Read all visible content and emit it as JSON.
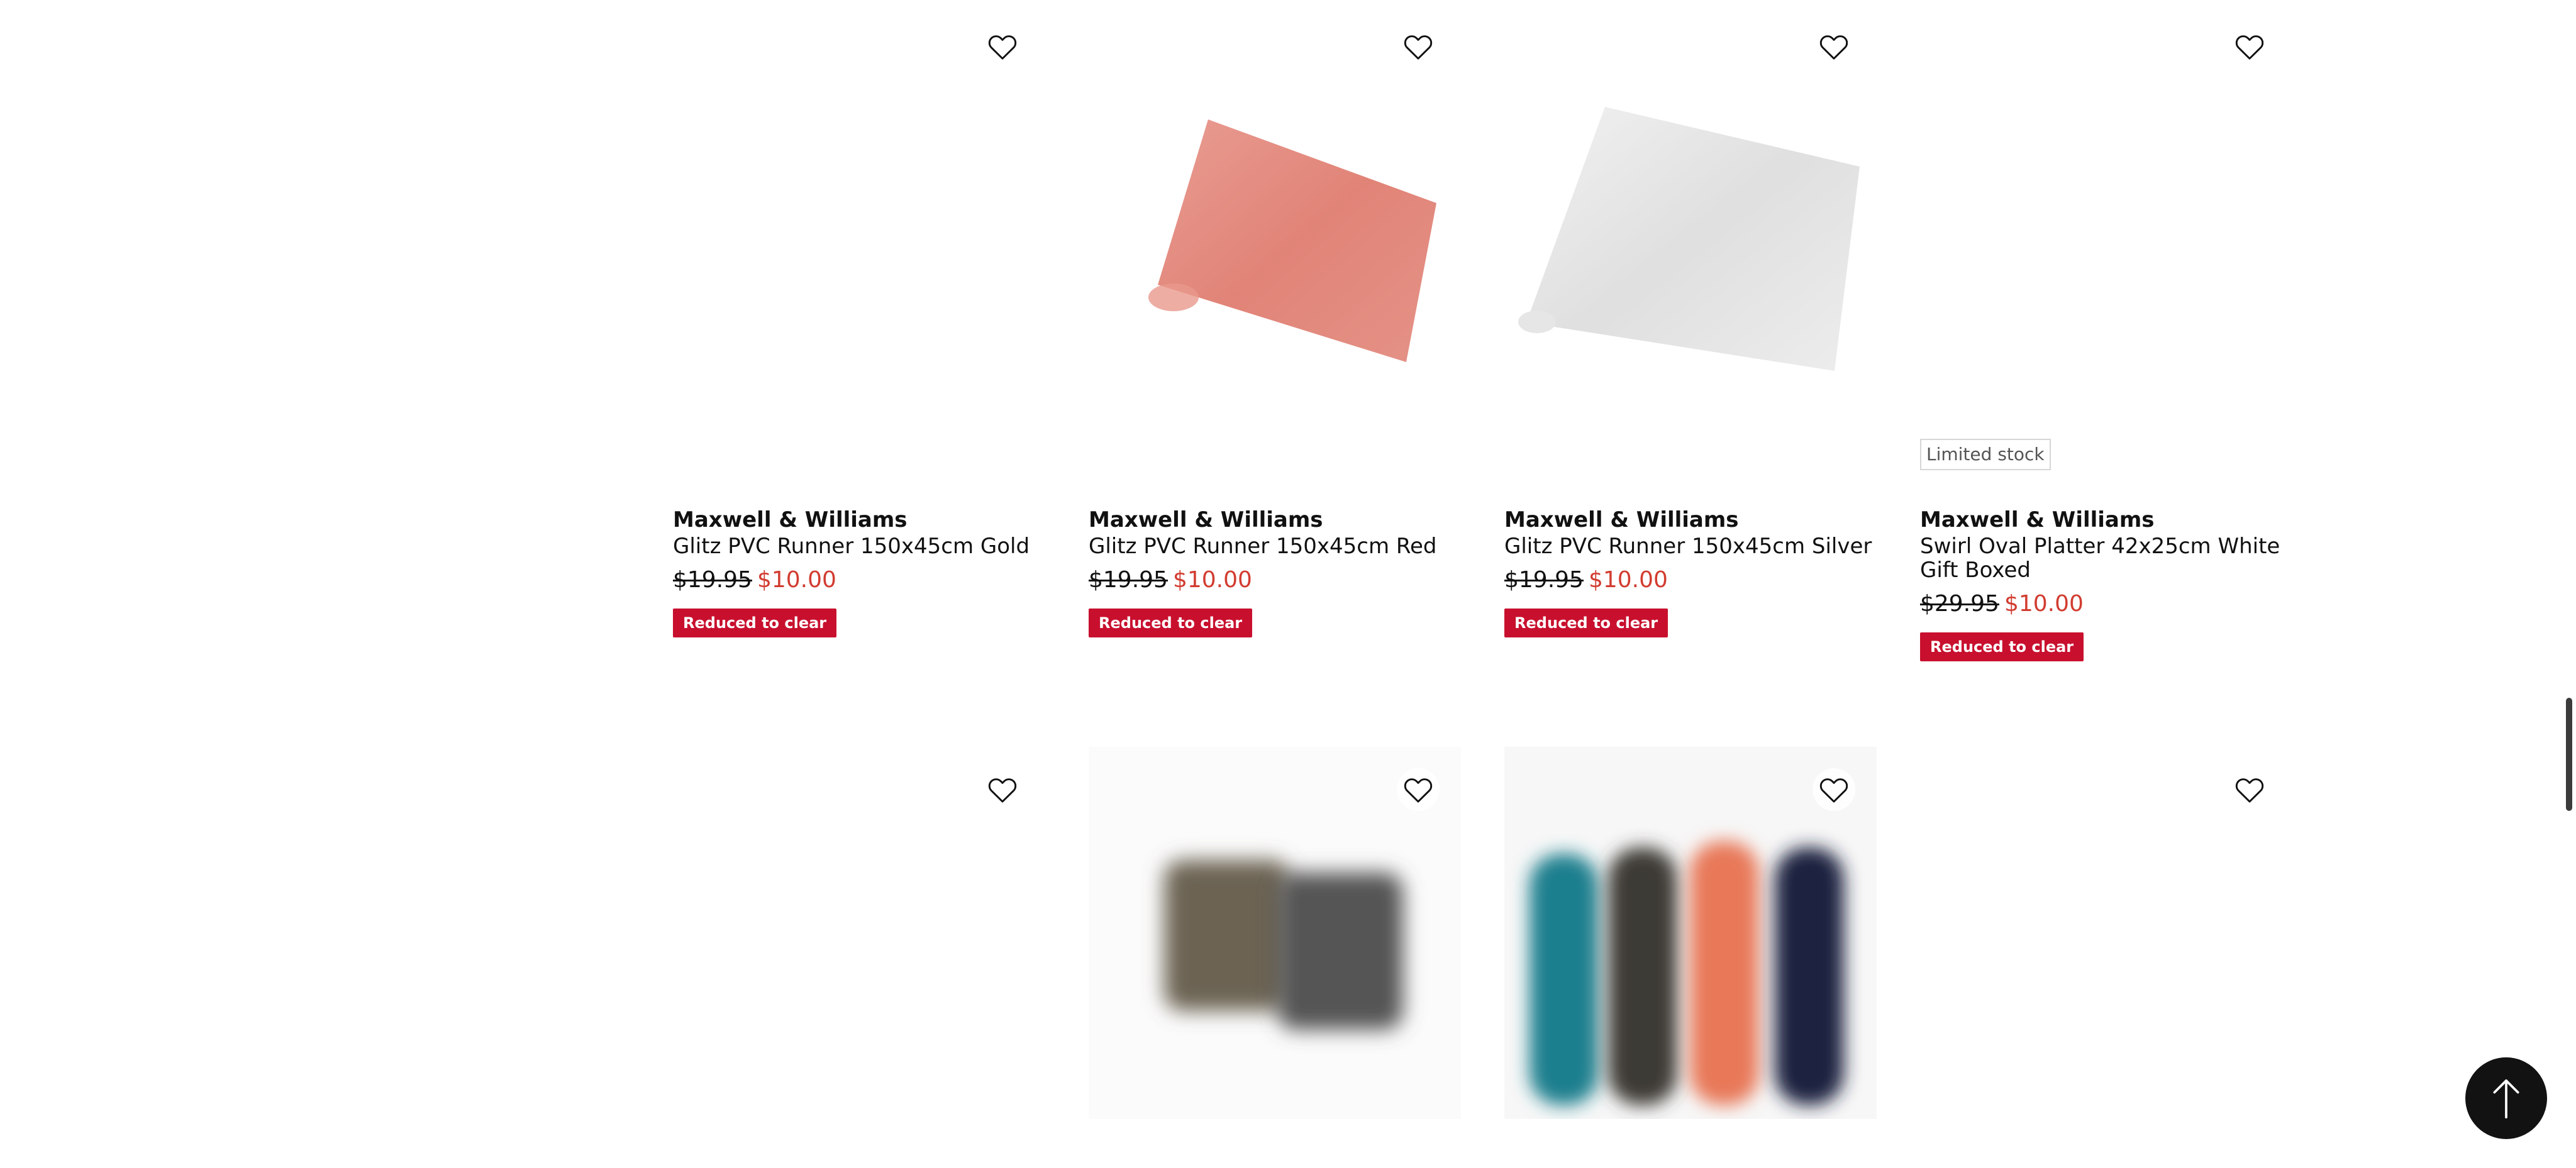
{
  "products_row1": [
    {
      "brand": "Maxwell & Williams",
      "name": "Glitz PVC Runner 150x45cm Gold",
      "was_price": "$19.95",
      "now_price": "$10.00",
      "badge": "Reduced to clear",
      "image_color": "#ffffff"
    },
    {
      "brand": "Maxwell & Williams",
      "name": "Glitz PVC Runner 150x45cm Red",
      "was_price": "$19.95",
      "now_price": "$10.00",
      "badge": "Reduced to clear",
      "image_color": "#e1776a"
    },
    {
      "brand": "Maxwell & Williams",
      "name": "Glitz PVC Runner 150x45cm Silver",
      "was_price": "$19.95",
      "now_price": "$10.00",
      "badge": "Reduced to clear",
      "image_color": "#e8e8e8"
    },
    {
      "brand": "Maxwell & Williams",
      "name": "Swirl Oval Platter 42x25cm White Gift Boxed",
      "was_price": "$29.95",
      "now_price": "$10.00",
      "badge": "Reduced to clear",
      "stock_label": "Limited stock",
      "image_color": "#ffffff"
    }
  ],
  "colors": {
    "sale_red": "#d23c30",
    "badge_red": "#c8102e",
    "back_to_top_bg": "#121212"
  },
  "icons": {
    "wishlist": "heart-outline-icon",
    "back_to_top": "arrow-up-icon"
  }
}
